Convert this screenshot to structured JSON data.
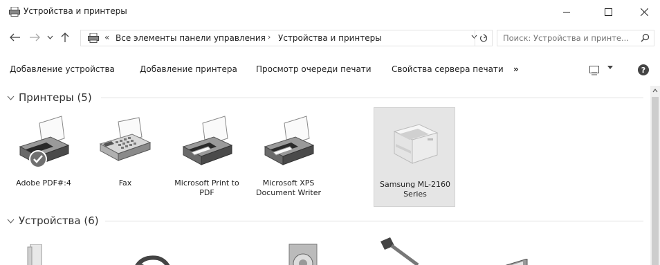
{
  "window": {
    "title": "Устройства и принтеры",
    "minimize_icon": "minimize-icon",
    "maximize_icon": "maximize-icon",
    "close_icon": "close-icon"
  },
  "address": {
    "prefix": "«",
    "crumb1": "Все элементы панели управления",
    "separator": "›",
    "crumb2": "Устройства и принтеры"
  },
  "search": {
    "placeholder": "Поиск: Устройства и принте..."
  },
  "commands": {
    "add_device": "Добавление устройства",
    "add_printer": "Добавление принтера",
    "print_queue": "Просмотр очереди печати",
    "server_props": "Свойства сервера печати",
    "more": "»"
  },
  "groups": {
    "printers": {
      "title": "Принтеры (5)",
      "items": [
        {
          "label": "Adobe PDF#:4",
          "icon": "printer-default-icon"
        },
        {
          "label": "Fax",
          "icon": "fax-icon"
        },
        {
          "label": "Microsoft Print to PDF",
          "icon": "printer-icon"
        },
        {
          "label": "Microsoft XPS Document Writer",
          "icon": "printer-icon"
        },
        {
          "label": "Samsung ML-2160 Series",
          "icon": "laser-printer-icon",
          "selected": true
        }
      ]
    },
    "devices": {
      "title": "Устройства (6)"
    }
  }
}
